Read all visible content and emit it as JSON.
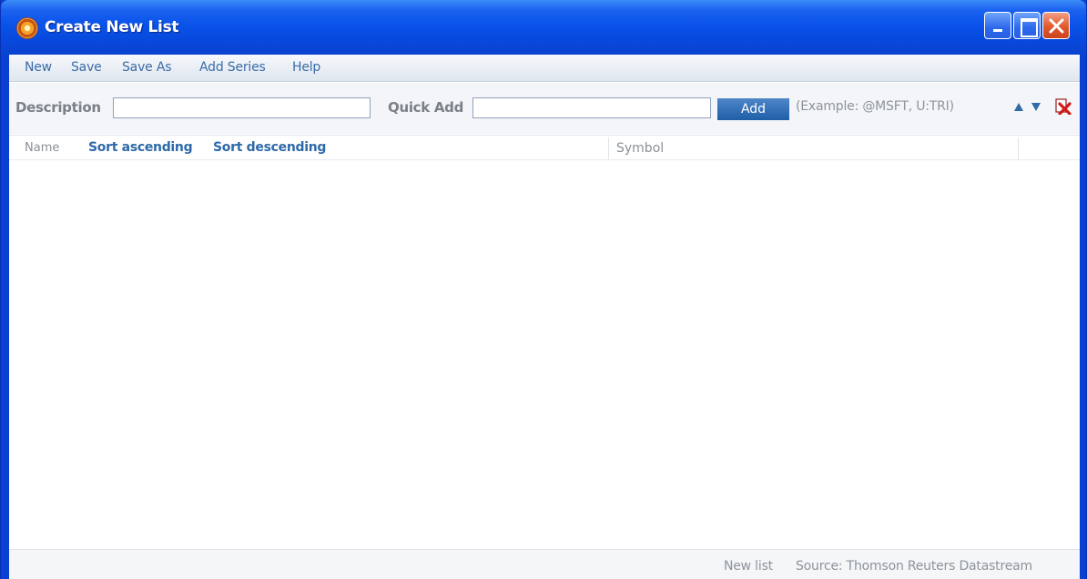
{
  "window": {
    "title": "Create New List"
  },
  "menu": {
    "items": [
      {
        "label": "New"
      },
      {
        "label": "Save"
      },
      {
        "label": "Save As"
      },
      {
        "label": "Add Series"
      },
      {
        "label": "Help"
      }
    ]
  },
  "toolbar": {
    "description_label": "Description",
    "description_value": "",
    "quick_add_label": "Quick Add",
    "quick_add_value": "",
    "add_button_label": "Add",
    "example_text": "(Example: @MSFT, U:TRI)"
  },
  "grid": {
    "name_header": "Name",
    "sort_ascending": "Sort ascending",
    "sort_descending": "Sort descending",
    "symbol_header": "Symbol",
    "rows": []
  },
  "status": {
    "list_state": "New list",
    "source": "Source: Thomson Reuters Datastream"
  },
  "icons": {
    "app": "app-logo-icon",
    "move_up": "arrow-up-icon",
    "move_down": "arrow-down-icon",
    "delete": "delete-icon"
  },
  "colors": {
    "titlebar": "#0a53ea",
    "accent": "#2f6aa8",
    "add_button": "#1f5ea8",
    "delete_icon": "#d11a1a"
  }
}
